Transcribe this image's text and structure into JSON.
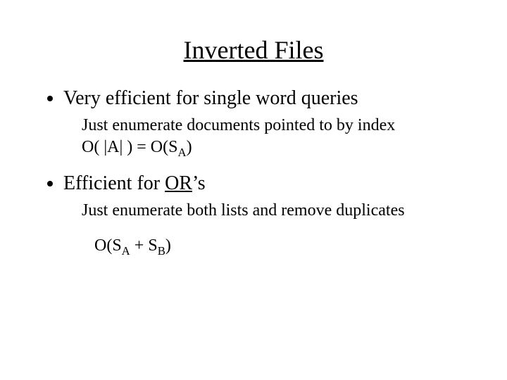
{
  "title": "Inverted Files",
  "bullets": [
    {
      "text": "Very efficient for single word queries",
      "sub_line1": "Just enumerate documents pointed to by index",
      "sub_line2_prefix": "O( |A| ) = O(S",
      "sub_line2_sub": "A",
      "sub_line2_suffix": ")"
    },
    {
      "prefix": "Efficient for ",
      "underlined": "OR",
      "suffix": "’s",
      "sub_line1": "Just enumerate both lists and remove duplicates",
      "sub_line2_prefix": "O(S",
      "sub_line2_sub1": "A",
      "sub_line2_mid": " + S",
      "sub_line2_sub2": "B",
      "sub_line2_suffix": ")"
    }
  ]
}
